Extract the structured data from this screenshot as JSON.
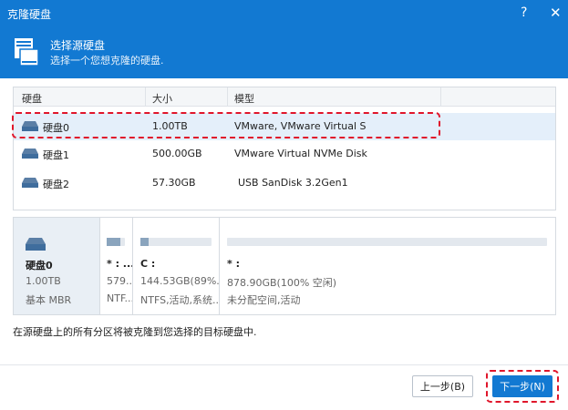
{
  "window": {
    "title": "克隆硬盘",
    "help_label": "?",
    "close_label": "✕"
  },
  "header": {
    "title": "选择源硬盘",
    "subtitle": "选择一个您想克隆的硬盘."
  },
  "table": {
    "columns": [
      "硬盘",
      "大小",
      "模型"
    ],
    "rows": [
      {
        "disk": "硬盘0",
        "size": "1.00TB",
        "model": "VMware, VMware Virtual S",
        "selected": true
      },
      {
        "disk": "硬盘1",
        "size": "500.00GB",
        "model": "VMware Virtual NVMe Disk",
        "selected": false
      },
      {
        "disk": "硬盘2",
        "size": "57.30GB",
        "model": "USB SanDisk 3.2Gen1",
        "selected": false
      }
    ]
  },
  "disk_info": {
    "name": "硬盘0",
    "size": "1.00TB",
    "type": "基本 MBR",
    "partitions": [
      {
        "label": "* : ...",
        "size": "579...",
        "fs": "NTF...",
        "used_fraction": 0.75
      },
      {
        "label": "C :",
        "size": "144.53GB(89%...",
        "fs": "NTFS,活动,系统...",
        "used_fraction": 0.11
      },
      {
        "label": "* :",
        "size": "878.90GB(100% 空闲)",
        "fs": "未分配空间,活动",
        "used_fraction": 0
      }
    ]
  },
  "note": "在源硬盘上的所有分区将被克隆到您选择的目标硬盘中.",
  "buttons": {
    "back": "上一步(B)",
    "next": "下一步(N)"
  },
  "colors": {
    "accent": "#1279d2",
    "highlight": "#e0162b",
    "selected_row": "#e4effa"
  }
}
